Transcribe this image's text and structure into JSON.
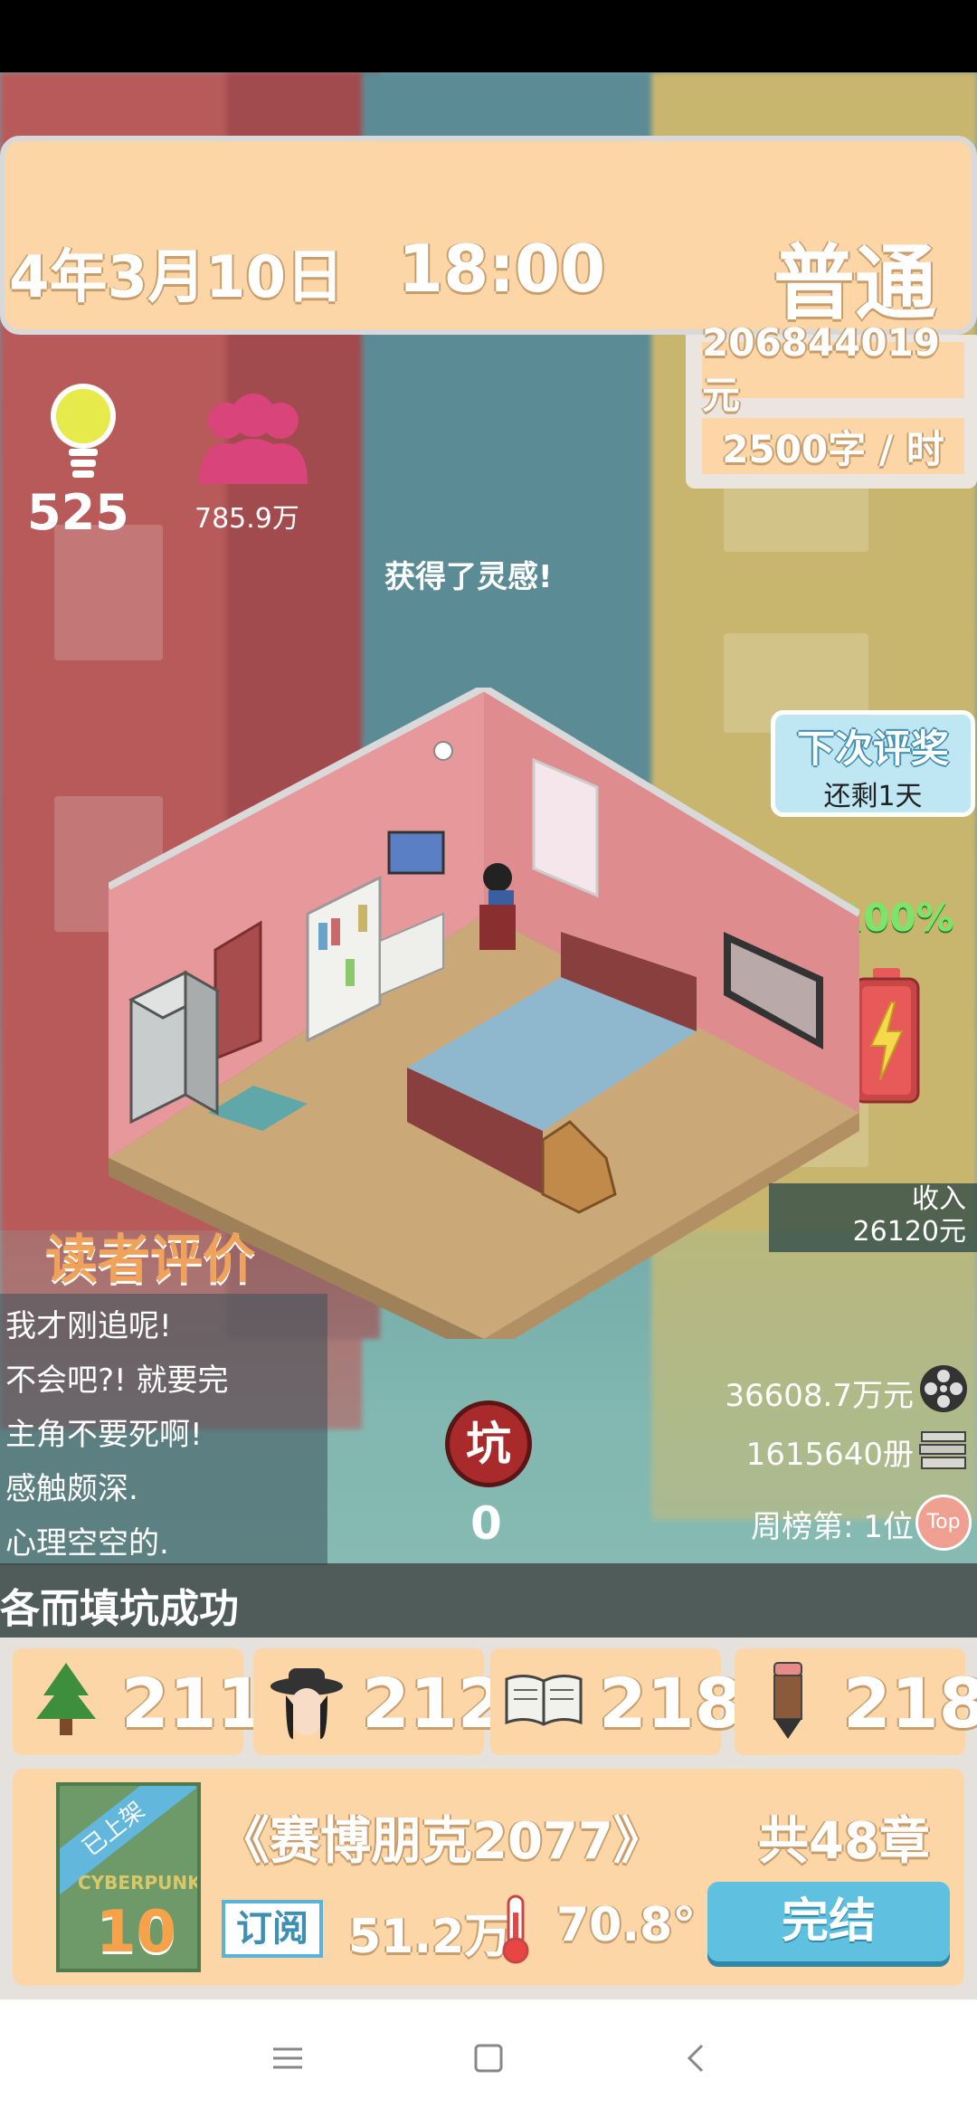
{
  "header": {
    "date": "4年3月10日",
    "time": "18:00",
    "mode": "普通"
  },
  "money": {
    "total": "206844019元",
    "rate": "2500字 / 时"
  },
  "stats_top": {
    "inspiration": "525",
    "fans": "785.9万"
  },
  "message": "获得了灵感!",
  "award": {
    "title": "下次评奖",
    "remaining": "还剩1天"
  },
  "battery": {
    "percent": "100%",
    "level": 1.0,
    "color": "#e84545"
  },
  "income": {
    "label": "收入",
    "value": "26120元"
  },
  "reviews": {
    "title": "读者评价",
    "items": [
      "我才刚追呢!",
      "不会吧?! 就要完",
      "主角不要死啊!",
      "感触颇深.",
      "心理空空的."
    ]
  },
  "stats_right": {
    "film": "36608.7万元",
    "books": "1615640册",
    "rank": "周榜第: 1位",
    "rank_badge": "Top"
  },
  "pit": {
    "label": "坑",
    "value": "0"
  },
  "marquee": "各而填坑成功",
  "attributes": [
    {
      "icon": "tree-icon",
      "value": "211"
    },
    {
      "icon": "detective-hat-icon",
      "value": "212"
    },
    {
      "icon": "open-book-icon",
      "value": "218"
    },
    {
      "icon": "pencil-icon",
      "value": "218"
    }
  ],
  "book": {
    "badge": "已上架",
    "cover_text": "CYBERPUNK",
    "volume": "10",
    "title": "《赛博朋克2077》",
    "chapters": "共48章",
    "subscribe_label": "订阅",
    "subscribers": "51.2万",
    "heat": "70.8°",
    "finish_label": "完结"
  },
  "colors": {
    "panel": "#fcd6a6",
    "accent_blue": "#5fc0e0",
    "review_title": "#f0a25a",
    "fans": "#d9457a",
    "bulb": "#e6ea4a"
  }
}
